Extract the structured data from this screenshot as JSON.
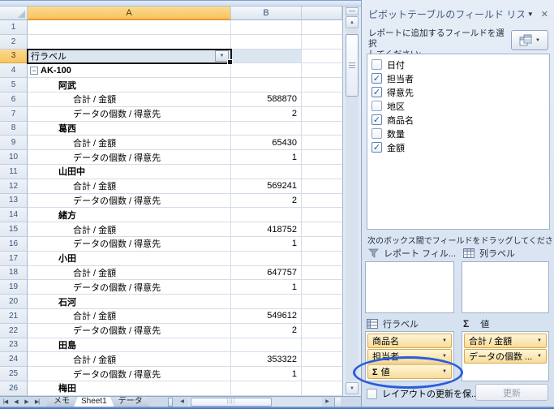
{
  "glyphs": {
    "dropdown": "▼",
    "collapse": "−",
    "check": "✓",
    "up": "▲",
    "down": "▼",
    "left": "◀",
    "right": "▶",
    "nav_first": "|◀",
    "nav_prev": "◀",
    "nav_next": "▶",
    "nav_last": "▶|",
    "grip_h": "||||",
    "sigma": "Σ",
    "close": "✕"
  },
  "colors": {
    "header_selected": "#F7C55E",
    "pivot_fill": "#DCE6F1",
    "field_button": "#F7DC9B",
    "ellipse_blue": "#2B5CD9",
    "panel_bg": "#D9E4F2"
  },
  "sheet": {
    "col_headers": [
      "A",
      "B"
    ],
    "selected_cell": "A3",
    "pivot_header": {
      "label": "行ラベル"
    },
    "rows": [
      {
        "n": 1
      },
      {
        "n": 2
      },
      {
        "n": 3,
        "type": "pivot_header"
      },
      {
        "n": 4,
        "label": "AK-100",
        "level": 0,
        "bold": true,
        "collapse": true
      },
      {
        "n": 5,
        "label": "阿武",
        "level": 1,
        "bold": true
      },
      {
        "n": 6,
        "label": "合計 / 金額",
        "level": 2,
        "value": "588870"
      },
      {
        "n": 7,
        "label": "データの個数 / 得意先",
        "level": 2,
        "value": "2"
      },
      {
        "n": 8,
        "label": "葛西",
        "level": 1,
        "bold": true
      },
      {
        "n": 9,
        "label": "合計 / 金額",
        "level": 2,
        "value": "65430"
      },
      {
        "n": 10,
        "label": "データの個数 / 得意先",
        "level": 2,
        "value": "1"
      },
      {
        "n": 11,
        "label": "山田中",
        "level": 1,
        "bold": true
      },
      {
        "n": 12,
        "label": "合計 / 金額",
        "level": 2,
        "value": "569241"
      },
      {
        "n": 13,
        "label": "データの個数 / 得意先",
        "level": 2,
        "value": "2"
      },
      {
        "n": 14,
        "label": "緒方",
        "level": 1,
        "bold": true
      },
      {
        "n": 15,
        "label": "合計 / 金額",
        "level": 2,
        "value": "418752"
      },
      {
        "n": 16,
        "label": "データの個数 / 得意先",
        "level": 2,
        "value": "1"
      },
      {
        "n": 17,
        "label": "小田",
        "level": 1,
        "bold": true
      },
      {
        "n": 18,
        "label": "合計 / 金額",
        "level": 2,
        "value": "647757"
      },
      {
        "n": 19,
        "label": "データの個数 / 得意先",
        "level": 2,
        "value": "1"
      },
      {
        "n": 20,
        "label": "石河",
        "level": 1,
        "bold": true
      },
      {
        "n": 21,
        "label": "合計 / 金額",
        "level": 2,
        "value": "549612"
      },
      {
        "n": 22,
        "label": "データの個数 / 得意先",
        "level": 2,
        "value": "2"
      },
      {
        "n": 23,
        "label": "田島",
        "level": 1,
        "bold": true
      },
      {
        "n": 24,
        "label": "合計 / 金額",
        "level": 2,
        "value": "353322"
      },
      {
        "n": 25,
        "label": "データの個数 / 得意先",
        "level": 2,
        "value": "1"
      },
      {
        "n": 26,
        "label": "梅田",
        "level": 1,
        "bold": true
      }
    ],
    "tabs": [
      {
        "label": "メモ",
        "active": false
      },
      {
        "label": "Sheet1",
        "active": true
      },
      {
        "label": "データ",
        "active": false
      }
    ]
  },
  "panel": {
    "title": "ピボットテーブルのフィールド リス",
    "choose_line1": "レポートに追加するフィールドを選択",
    "choose_line2": "してください:",
    "fields": [
      {
        "label": "日付",
        "checked": false
      },
      {
        "label": "担当者",
        "checked": true
      },
      {
        "label": "得意先",
        "checked": true
      },
      {
        "label": "地区",
        "checked": false
      },
      {
        "label": "商品名",
        "checked": true
      },
      {
        "label": "数量",
        "checked": false
      },
      {
        "label": "金額",
        "checked": true
      }
    ],
    "drag_label": "次のボックス間でフィールドをドラッグしてください:",
    "areas": {
      "report_filter": {
        "label": "レポート フィル...",
        "items": []
      },
      "column_labels": {
        "label": "列ラベル",
        "items": []
      },
      "row_labels": {
        "label": "行ラベル",
        "items": [
          {
            "label": "商品名"
          },
          {
            "label": "担当者"
          },
          {
            "label": "値",
            "sigma": true,
            "circled": true
          }
        ]
      },
      "values": {
        "label": "値",
        "items": [
          {
            "label": "合計 / 金額"
          },
          {
            "label": "データの個数 ..."
          }
        ]
      }
    },
    "defer_label": "レイアウトの更新を保...",
    "update_button": "更新"
  }
}
